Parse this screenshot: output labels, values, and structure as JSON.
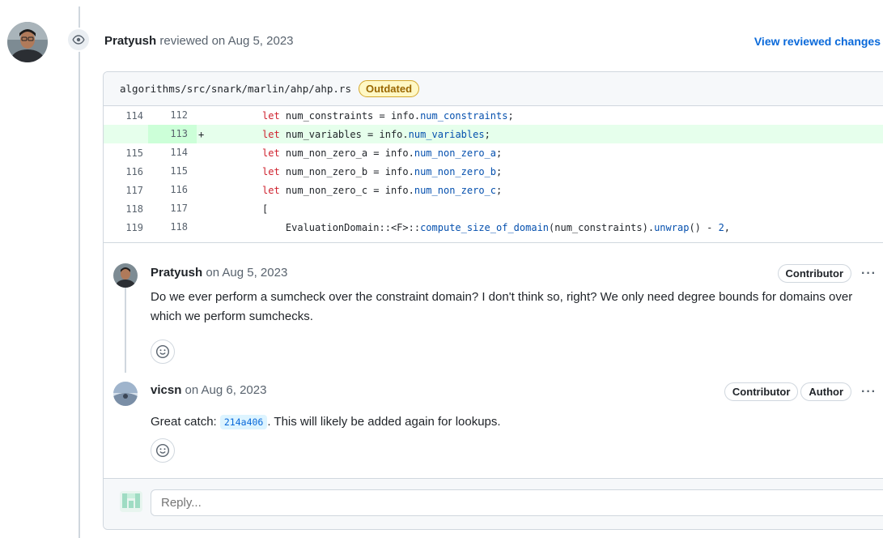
{
  "review": {
    "author": "Pratyush",
    "action": "reviewed on Aug 5, 2023",
    "view_changes_label": "View reviewed changes",
    "page_avatar_icon": "avatar-photo-icon",
    "eye_icon": "eye-icon"
  },
  "file": {
    "path": "algorithms/src/snark/marlin/ahp/ahp.rs",
    "status_badge": "Outdated"
  },
  "diff": {
    "lines": [
      {
        "old": "114",
        "new": "112",
        "marker": "",
        "kind": "context"
      },
      {
        "old": "",
        "new": "113",
        "marker": "+",
        "kind": "added"
      },
      {
        "old": "115",
        "new": "114",
        "marker": "",
        "kind": "context"
      },
      {
        "old": "116",
        "new": "115",
        "marker": "",
        "kind": "context"
      },
      {
        "old": "117",
        "new": "116",
        "marker": "",
        "kind": "context"
      },
      {
        "old": "118",
        "new": "117",
        "marker": "",
        "kind": "context"
      },
      {
        "old": "119",
        "new": "118",
        "marker": "",
        "kind": "context"
      }
    ],
    "code": {
      "l1_kw": "let",
      "l1_var": " num_constraints = info.",
      "l1_field": "num_constraints",
      "l1_end": ";",
      "l2_kw": "let",
      "l2_var": " num_variables = info.",
      "l2_field": "num_variables",
      "l2_end": ";",
      "l3_kw": "let",
      "l3_var": " num_non_zero_a = info.",
      "l3_field": "num_non_zero_a",
      "l3_end": ";",
      "l4_kw": "let",
      "l4_var": " num_non_zero_b = info.",
      "l4_field": "num_non_zero_b",
      "l4_end": ";",
      "l5_kw": "let",
      "l5_var": " num_non_zero_c = info.",
      "l5_field": "num_non_zero_c",
      "l5_end": ";",
      "l6": "[",
      "l7_pre": "    EvaluationDomain::<F>::",
      "l7_fn": "compute_size_of_domain",
      "l7_mid": "(num_constraints).",
      "l7_fn2": "unwrap",
      "l7_post": "() - ",
      "l7_num": "2",
      "l7_end": ","
    }
  },
  "comments": [
    {
      "author": "Pratyush",
      "date": "on Aug 5, 2023",
      "badges": [
        "Contributor"
      ],
      "body": "Do we ever perform a sumcheck over the constraint domain? I don't think so, right? We only need degree bounds for domains over which we perform sumchecks.",
      "more_label": "···",
      "reaction_icon": "smiley-icon"
    },
    {
      "author": "vicsn",
      "date": "on Aug 6, 2023",
      "badges": [
        "Contributor",
        "Author"
      ],
      "body_pre": "Great catch: ",
      "commit": "214a406",
      "body_post": ". This will likely be added again for lookups.",
      "more_label": "···",
      "reaction_icon": "smiley-icon"
    }
  ],
  "reply": {
    "placeholder": "Reply..."
  },
  "colors": {
    "link": "#0969da",
    "added_bg": "#e6ffec",
    "keyword": "#cf222e",
    "identifier": "#0550ae",
    "outdated_text": "#9a6700"
  }
}
